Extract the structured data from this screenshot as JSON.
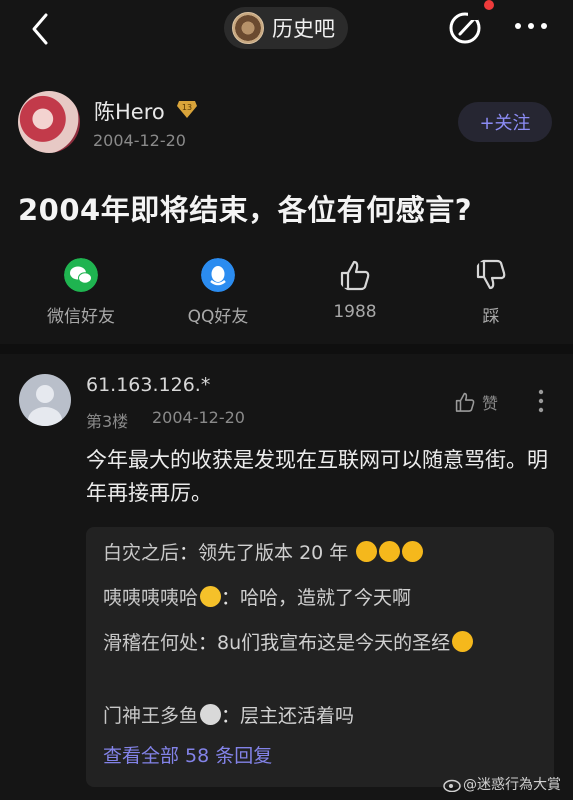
{
  "header": {
    "forum_name": "历史吧",
    "icons": [
      "back-arrow-icon",
      "forum-logo-icon",
      "edit-post-icon",
      "more-dots-icon"
    ]
  },
  "post": {
    "author": "陈Hero",
    "level_badge": "13",
    "date": "2004-12-20",
    "follow_label": "+关注",
    "title": "2004年即将结束，各位有何感言?"
  },
  "actions": [
    {
      "label": "微信好友",
      "icon": "wechat-icon"
    },
    {
      "label": "QQ好友",
      "icon": "qq-icon"
    },
    {
      "label": "1988",
      "icon": "thumbs-up-icon"
    },
    {
      "label": "踩",
      "icon": "thumbs-down-icon"
    }
  ],
  "comment": {
    "user": "61.163.126.*",
    "floor": "第3楼",
    "date": "2004-12-20",
    "like_label": "赞",
    "body": "今年最大的收获是发现在互联网可以随意骂街。明年再接再厉。",
    "replies": [
      {
        "name": "白灾之后",
        "sep": "：",
        "text": "领先了版本 20 年",
        "emoji": [
          "grin-squint-emoji",
          "grin-squint-emoji",
          "grin-squint-emoji"
        ]
      },
      {
        "name": "咦咦咦咦哈",
        "sep": "：",
        "text": "哈哈，造就了今天啊",
        "name_emoji": "tears-of-joy-emoji"
      },
      {
        "name": "滑稽在何处",
        "sep": "：",
        "text": "8u们我宣布这是今天的圣经",
        "emoji": [
          "grin-emoji"
        ]
      },
      {
        "name": "门神王多鱼",
        "sep": "：",
        "text": "层主还活着吗",
        "name_emoji": "mouse-face-emoji"
      }
    ],
    "view_all": "查看全部 58 条回复"
  },
  "watermark": "@迷惑行為大賞",
  "colors": {
    "background": "#151515",
    "accent_link": "#8383e8",
    "follow_text": "#8c8cf5",
    "wechat_green": "#1fb450",
    "qq_blue": "#2b8cf0",
    "notification_red": "#ee3b3b"
  }
}
